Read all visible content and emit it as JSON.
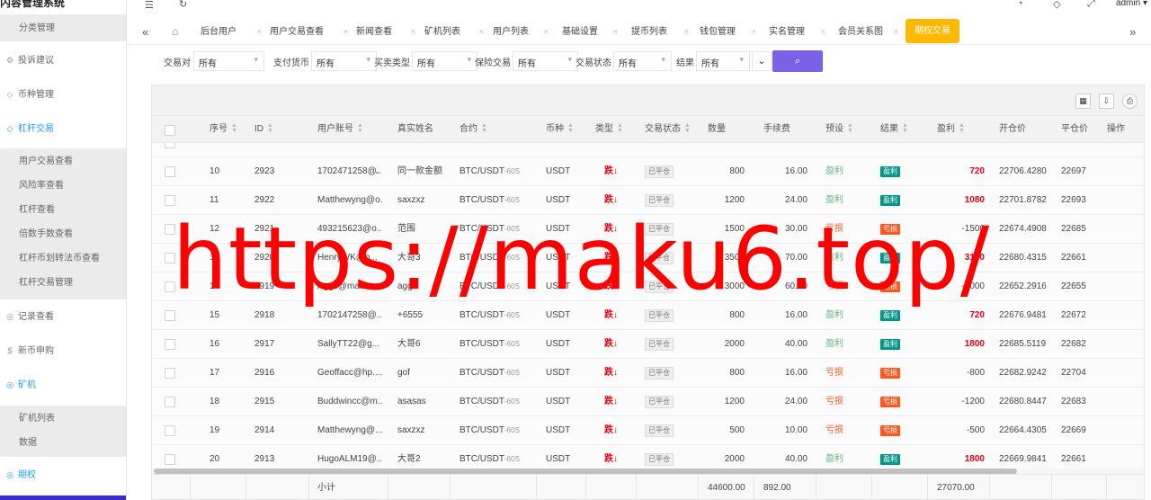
{
  "app": {
    "title": "内容管理系统",
    "user": "admin"
  },
  "sidebar": {
    "top_sub": "分类管理",
    "items": [
      {
        "label": "投诉建议",
        "icon": "gear-icon",
        "active": false
      },
      {
        "label": "币种管理",
        "icon": "diamond-icon",
        "active": false
      },
      {
        "label": "杠杆交易",
        "icon": "diamond-icon",
        "active": true
      }
    ],
    "leverage_sub": [
      "用户交易查看",
      "风险率查看",
      "杠杆查看",
      "倍数手数查看",
      "杠杆币划转法币查看",
      "杠杆交易管理"
    ],
    "items2": [
      {
        "label": "记录查看",
        "icon": "circle-arrow-icon",
        "active": false
      },
      {
        "label": "新币申购",
        "icon": "dollar-icon",
        "active": false
      },
      {
        "label": "矿机",
        "icon": "circle-arrow-icon",
        "active": true
      }
    ],
    "miner_sub": [
      "矿机列表",
      "数据"
    ],
    "items3": [
      {
        "label": "期权",
        "icon": "circle-arrow-icon",
        "active": true
      }
    ]
  },
  "tabs": [
    {
      "label": "后台用户"
    },
    {
      "label": "用户交易查看"
    },
    {
      "label": "新闻查看"
    },
    {
      "label": "矿机列表"
    },
    {
      "label": "用户列表"
    },
    {
      "label": "基础设置"
    },
    {
      "label": "提币列表"
    },
    {
      "label": "钱包管理"
    },
    {
      "label": "实名管理"
    },
    {
      "label": "会员关系图"
    },
    {
      "label": "期权交易",
      "active": true
    }
  ],
  "filters": [
    {
      "label": "交易对",
      "value": "所有"
    },
    {
      "label": "支付货币",
      "value": "所有"
    },
    {
      "label": "买卖类型",
      "value": "所有"
    },
    {
      "label": "保险交易",
      "value": "所有"
    },
    {
      "label": "交易状态",
      "value": "所有"
    },
    {
      "label": "结果",
      "value": "所有"
    }
  ],
  "table": {
    "headers": [
      "序号",
      "ID",
      "用户账号",
      "真实姓名",
      "合约",
      "币种",
      "类型",
      "交易状态",
      "数量",
      "手续费",
      "预设",
      "结果",
      "盈利",
      "开仓价",
      "平仓价",
      "操作"
    ],
    "rows": [
      {
        "no": "10",
        "id": "2923",
        "account": "1702471258@...",
        "name": "同一款金额",
        "contract": "BTC/USDT",
        "period": "-60S",
        "currency": "USDT",
        "type": "跌↓",
        "status": "已平仓",
        "qty": "800",
        "fee": "16.00",
        "preset": "盈利",
        "result": "盈利",
        "profit": "720",
        "open": "22706.4280",
        "close": "22697"
      },
      {
        "no": "11",
        "id": "2922",
        "account": "Matthewyng@o...",
        "name": "saxzxz",
        "contract": "BTC/USDT",
        "period": "-60S",
        "currency": "USDT",
        "type": "跌↓",
        "status": "已平仓",
        "qty": "1200",
        "fee": "24.00",
        "preset": "盈利",
        "result": "盈利",
        "profit": "1080",
        "open": "22701.8782",
        "close": "22693"
      },
      {
        "no": "12",
        "id": "2921",
        "account": "493215623@o...",
        "name": "范围",
        "contract": "BTC/USDT",
        "period": "-60S",
        "currency": "USDT",
        "type": "跌↓",
        "status": "已平仓",
        "qty": "1500",
        "fee": "30.00",
        "preset": "亏损",
        "result": "亏损",
        "profit": "-1500",
        "open": "22674.4908",
        "close": "22685"
      },
      {
        "no": "13",
        "id": "2920",
        "account": "HenryWK@o...",
        "name": "大哥3",
        "contract": "BTC/USDT",
        "period": "-60S",
        "currency": "USDT",
        "type": "跌↓",
        "status": "已平仓",
        "qty": "3500",
        "fee": "70.00",
        "preset": "盈利",
        "result": "盈利",
        "profit": "3150",
        "open": "22680.4315",
        "close": "22661"
      },
      {
        "no": "14",
        "id": "2919",
        "account": "Aggc@mail.c...",
        "name": "agg",
        "contract": "BTC/USDT",
        "period": "-60S",
        "currency": "USDT",
        "type": "跌↓",
        "status": "已平仓",
        "qty": "3000",
        "fee": "60.00",
        "preset": "亏损",
        "result": "亏损",
        "profit": "-3000",
        "open": "22652.2916",
        "close": "22655"
      },
      {
        "no": "15",
        "id": "2918",
        "account": "1702147258@...",
        "name": "+6555",
        "contract": "BTC/USDT",
        "period": "-60S",
        "currency": "USDT",
        "type": "跌↓",
        "status": "已平仓",
        "qty": "800",
        "fee": "16.00",
        "preset": "盈利",
        "result": "盈利",
        "profit": "720",
        "open": "22676.9481",
        "close": "22672"
      },
      {
        "no": "16",
        "id": "2917",
        "account": "SallyTT22@g...",
        "name": "大哥6",
        "contract": "BTC/USDT",
        "period": "-60S",
        "currency": "USDT",
        "type": "跌↓",
        "status": "已平仓",
        "qty": "2000",
        "fee": "40.00",
        "preset": "盈利",
        "result": "盈利",
        "profit": "1800",
        "open": "22685.5119",
        "close": "22682"
      },
      {
        "no": "17",
        "id": "2916",
        "account": "Geoffacc@hp....",
        "name": "gof",
        "contract": "BTC/USDT",
        "period": "-60S",
        "currency": "USDT",
        "type": "跌↓",
        "status": "已平仓",
        "qty": "800",
        "fee": "16.00",
        "preset": "亏损",
        "result": "亏损",
        "profit": "-800",
        "open": "22682.9242",
        "close": "22704"
      },
      {
        "no": "18",
        "id": "2915",
        "account": "Buddwincc@m...",
        "name": "asasas",
        "contract": "BTC/USDT",
        "period": "-60S",
        "currency": "USDT",
        "type": "跌↓",
        "status": "已平仓",
        "qty": "1200",
        "fee": "24.00",
        "preset": "亏损",
        "result": "亏损",
        "profit": "-1200",
        "open": "22680.8447",
        "close": "22683"
      },
      {
        "no": "19",
        "id": "2914",
        "account": "Matthewyng@...",
        "name": "saxzxz",
        "contract": "BTC/USDT",
        "period": "-60S",
        "currency": "USDT",
        "type": "跌↓",
        "status": "已平仓",
        "qty": "500",
        "fee": "10.00",
        "preset": "亏损",
        "result": "亏损",
        "profit": "-500",
        "open": "22664.4305",
        "close": "22669"
      },
      {
        "no": "20",
        "id": "2913",
        "account": "HugoALM19@...",
        "name": "大哥2",
        "contract": "BTC/USDT",
        "period": "-60S",
        "currency": "USDT",
        "type": "跌↓",
        "status": "已平仓",
        "qty": "2000",
        "fee": "40.00",
        "preset": "盈利",
        "result": "盈利",
        "profit": "1800",
        "open": "22669.9841",
        "close": "22661"
      }
    ],
    "footer": {
      "label": "小计",
      "qty": "44600.00",
      "fee": "892.00",
      "profit": "27070.00"
    }
  },
  "watermark": "https://maku6.top/"
}
